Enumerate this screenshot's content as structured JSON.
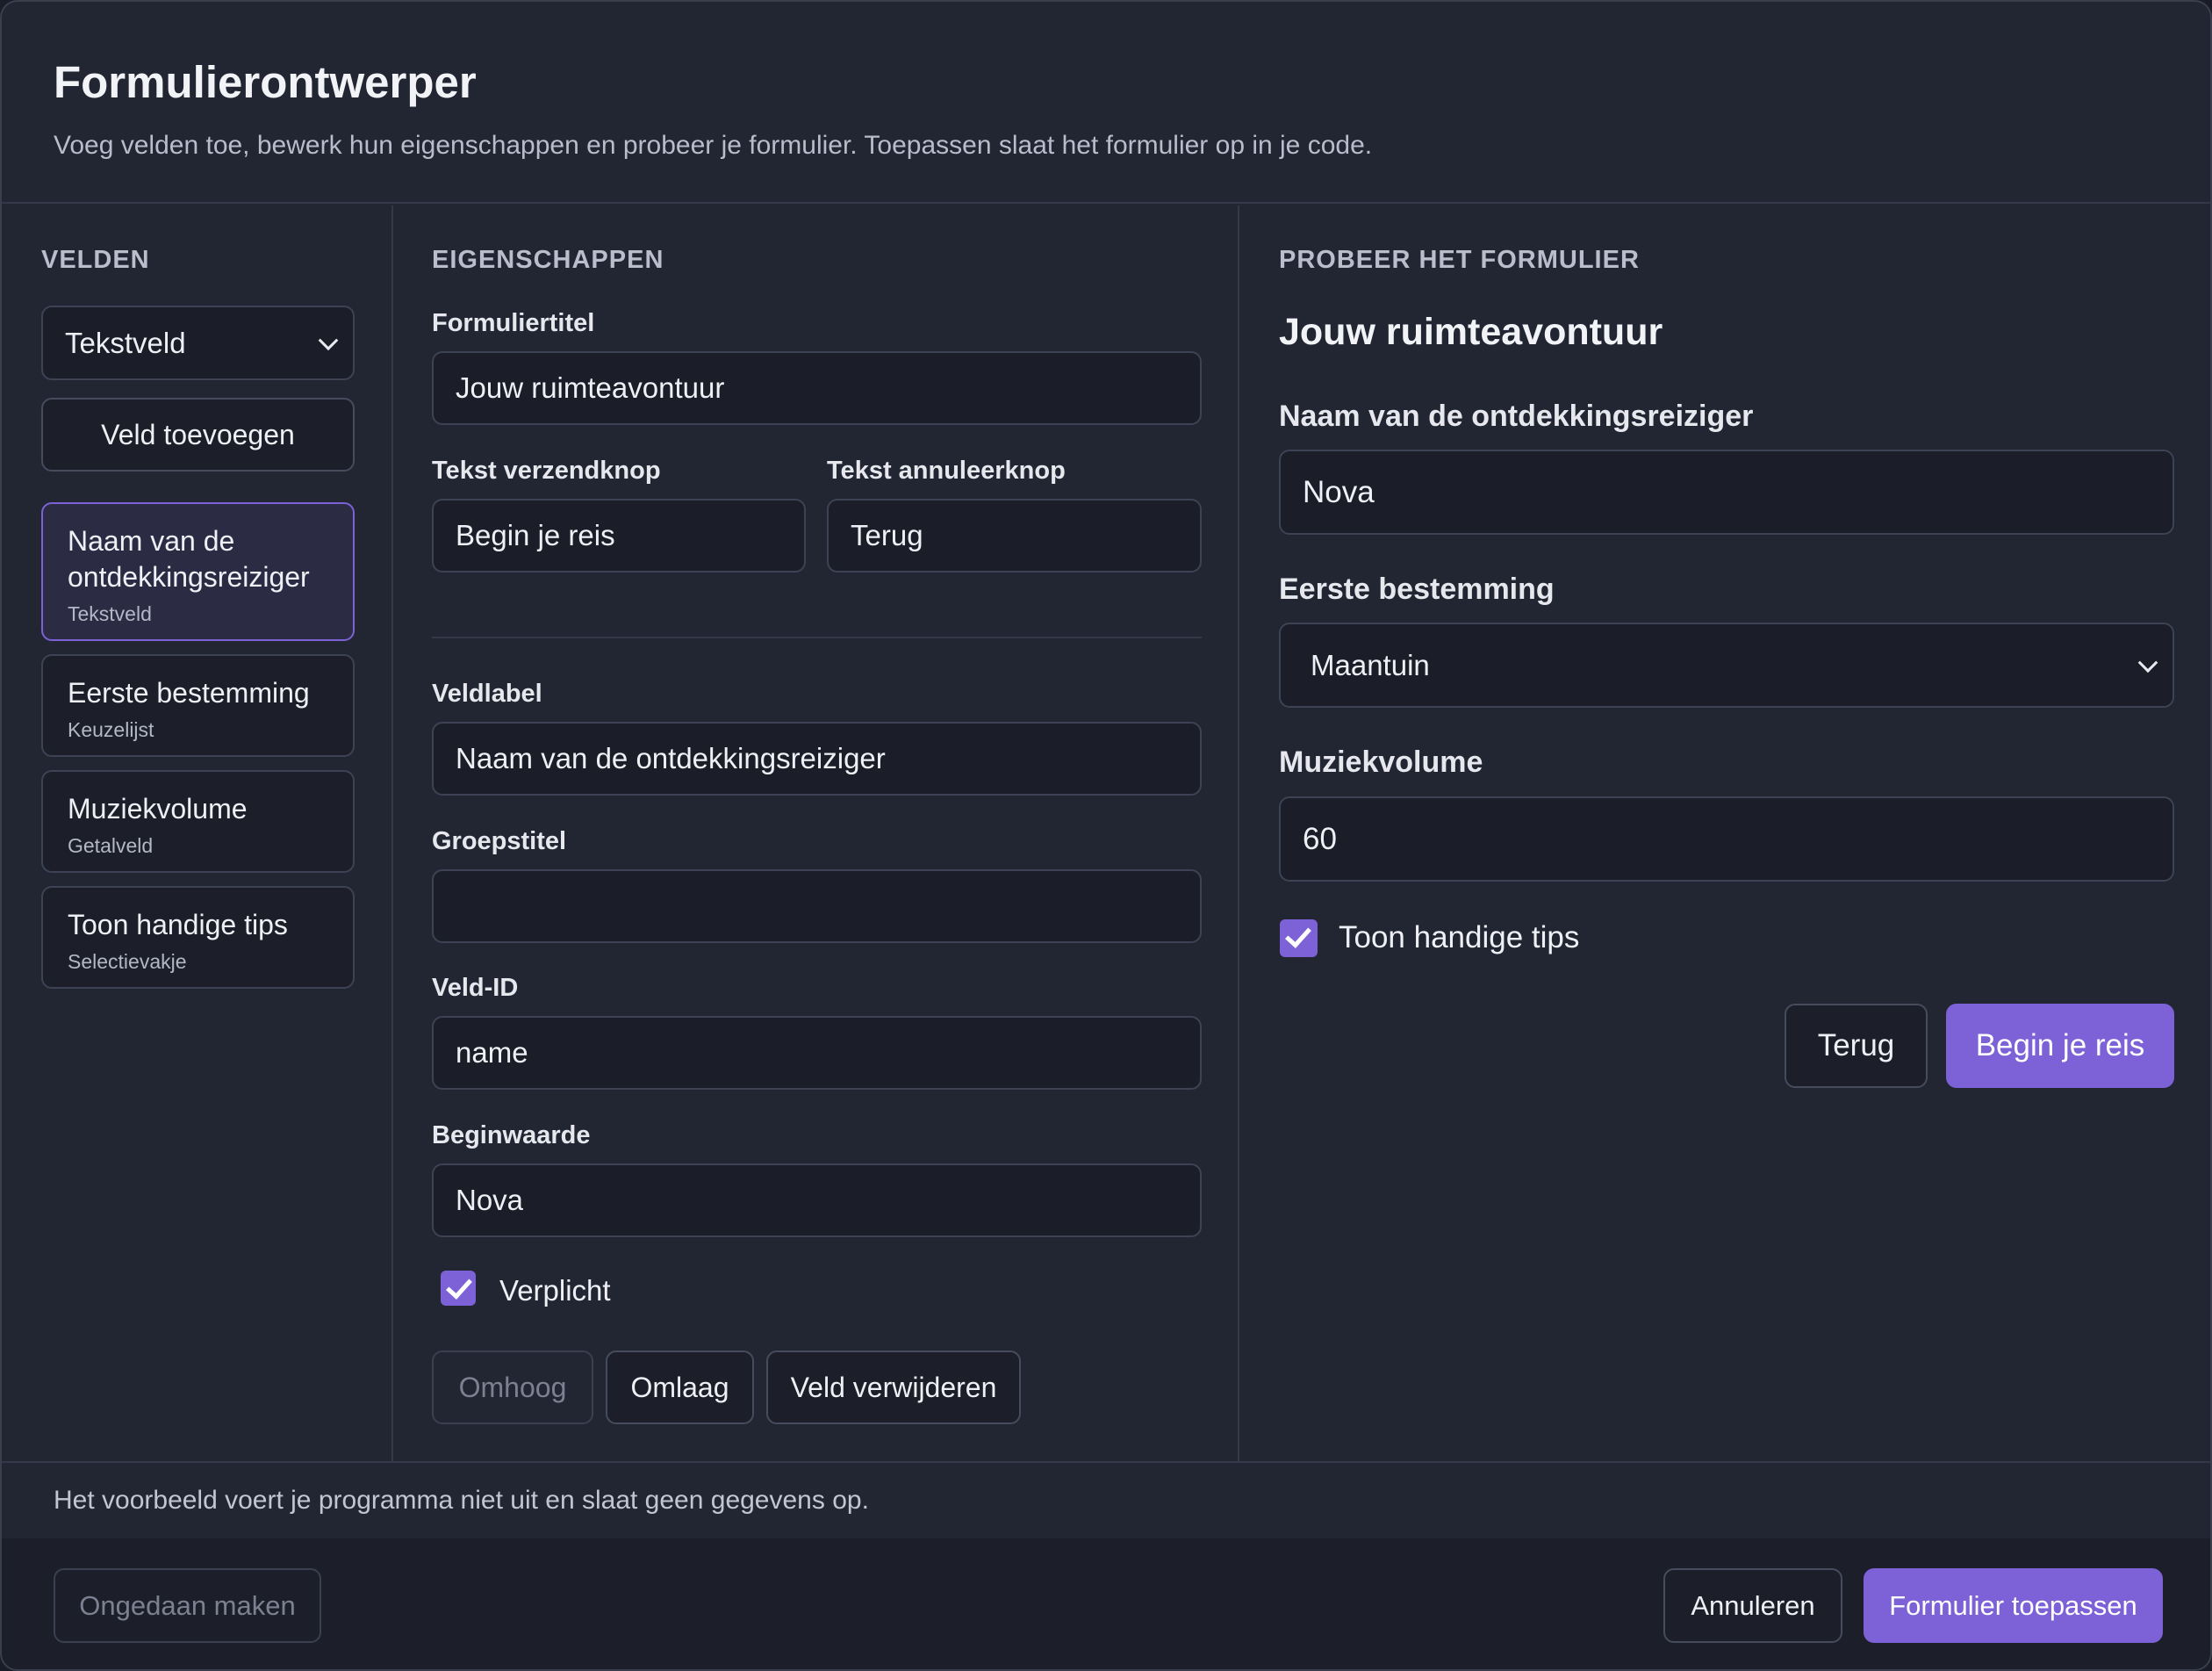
{
  "dialog": {
    "title": "Formulierontwerper",
    "subtitle": "Voeg velden toe, bewerk hun eigenschappen en probeer je formulier. Toepassen slaat het formulier op in je code."
  },
  "fields_panel": {
    "heading": "VELDEN",
    "type_select": "Tekstveld",
    "add_button": "Veld toevoegen",
    "items": [
      {
        "name": "Naam van de ontdekkingsreiziger",
        "type": "Tekstveld"
      },
      {
        "name": "Eerste bestemming",
        "type": "Keuzelijst"
      },
      {
        "name": "Muziekvolume",
        "type": "Getalveld"
      },
      {
        "name": "Toon handige tips",
        "type": "Selectievakje"
      }
    ]
  },
  "properties": {
    "heading": "EIGENSCHAPPEN",
    "form_title_label": "Formuliertitel",
    "form_title_value": "Jouw ruimteavontuur",
    "submit_label": "Tekst verzendknop",
    "submit_value": "Begin je reis",
    "cancel_label": "Tekst annuleerknop",
    "cancel_value": "Terug",
    "field_label_label": "Veldlabel",
    "field_label_value": "Naam van de ontdekkingsreiziger",
    "group_title_label": "Groepstitel",
    "group_title_value": "",
    "field_id_label": "Veld-ID",
    "field_id_value": "name",
    "initial_value_label": "Beginwaarde",
    "initial_value_value": "Nova",
    "required_label": "Verplicht",
    "required_checked": true,
    "move_up": "Omhoog",
    "move_down": "Omlaag",
    "delete_field": "Veld verwijderen"
  },
  "preview": {
    "heading": "PROBEER HET FORMULIER",
    "form_title": "Jouw ruimteavontuur",
    "name_label": "Naam van de ontdekkingsreiziger",
    "name_value": "Nova",
    "destination_label": "Eerste bestemming",
    "destination_value": "Maantuin",
    "volume_label": "Muziekvolume",
    "volume_value": "60",
    "tips_label": "Toon handige tips",
    "tips_checked": true,
    "back_button": "Terug",
    "submit_button": "Begin je reis"
  },
  "note": "Het voorbeeld voert je programma niet uit en slaat geen gegevens op.",
  "footer": {
    "undo": "Ongedaan maken",
    "cancel": "Annuleren",
    "apply": "Formulier toepassen"
  },
  "colors": {
    "accent": "#7c62d6",
    "background": "#222633",
    "input_bg": "#1b1e28"
  }
}
